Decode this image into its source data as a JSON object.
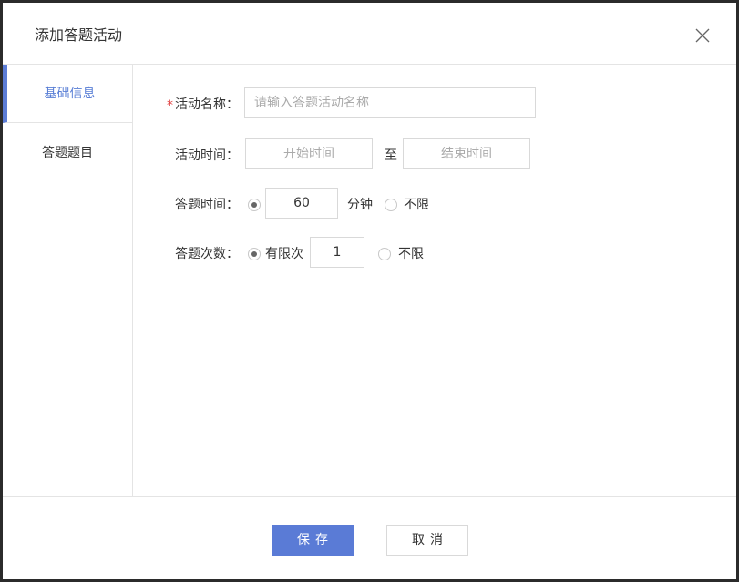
{
  "dialog": {
    "title": "添加答题活动"
  },
  "sidebar": {
    "items": [
      {
        "label": "基础信息",
        "active": true
      },
      {
        "label": "答题题目",
        "active": false
      }
    ]
  },
  "form": {
    "name": {
      "required_mark": "*",
      "label": "活动名称：",
      "value": "",
      "placeholder": "请输入答题活动名称"
    },
    "time": {
      "label": "活动时间：",
      "start_placeholder": "开始时间",
      "separator": "至",
      "end_placeholder": "结束时间"
    },
    "duration": {
      "label": "答题时间：",
      "limited_selected": true,
      "value": "60",
      "unit": "分钟",
      "unlimited_label": "不限"
    },
    "attempts": {
      "label": "答题次数：",
      "limited_selected": true,
      "limited_label": "有限次",
      "value": "1",
      "unlimited_label": "不限"
    }
  },
  "footer": {
    "save_label": "保存",
    "cancel_label": "取消"
  },
  "colors": {
    "accent": "#5a7bd6",
    "required": "#e03c3c"
  },
  "icons": {
    "close": "close-icon"
  }
}
